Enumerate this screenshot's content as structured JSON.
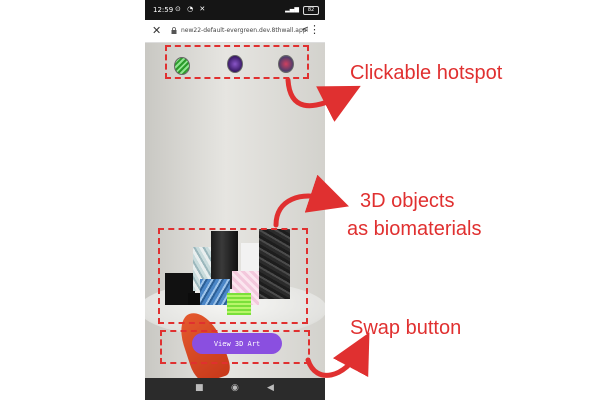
{
  "status_bar": {
    "time": "12:59",
    "battery": "82"
  },
  "browser": {
    "url": "new22-default-evergreen.dev.8thwall.app"
  },
  "hotspots": [
    {
      "name": "green-material",
      "color": "#2a9a2a"
    },
    {
      "name": "purple-material",
      "color": "#5a2a90"
    },
    {
      "name": "red-material",
      "color": "#c03050"
    }
  ],
  "view_button": {
    "label": "View 3D Art"
  },
  "annotations": {
    "hotspot_label": "Clickable hotspot",
    "objects_label_line1": "3D objects",
    "objects_label_line2": "as biomaterials",
    "swap_label": "Swap button",
    "annotation_color": "#e03030"
  },
  "nav": {
    "square_icon": "■",
    "home_icon": "◉",
    "back_icon": "◀"
  }
}
